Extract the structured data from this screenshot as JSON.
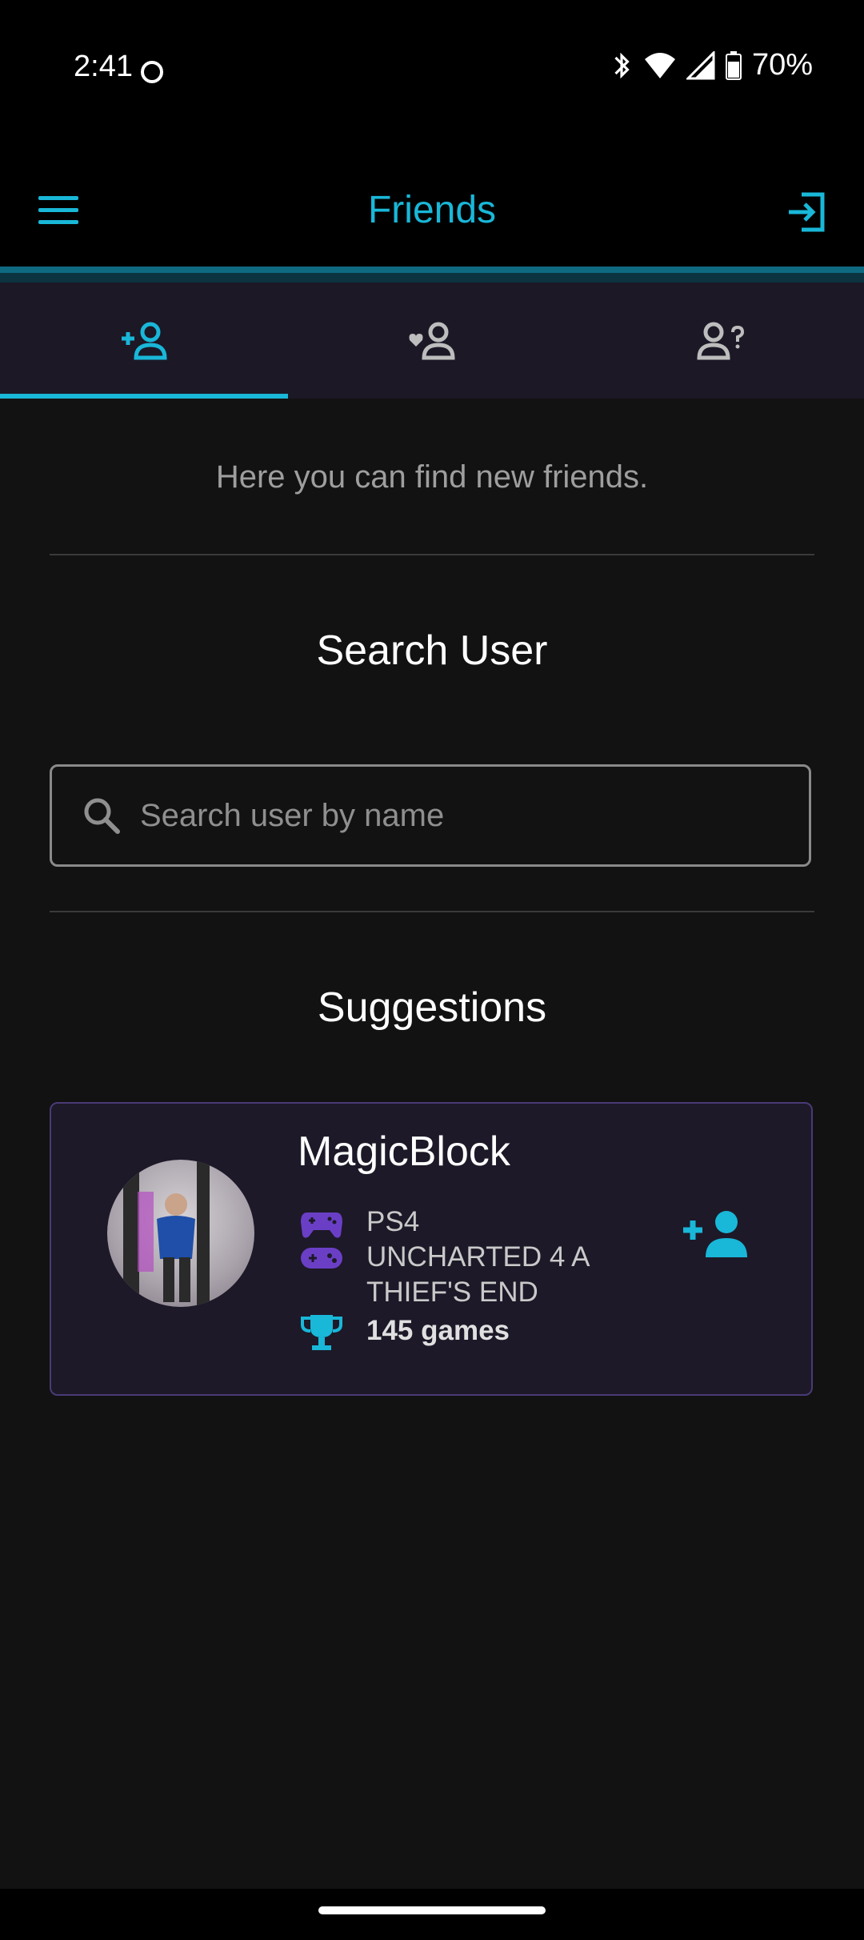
{
  "status_bar": {
    "time": "2:41",
    "battery": "70%"
  },
  "app_bar": {
    "title": "Friends"
  },
  "tabs": [
    {
      "name": "find-friends",
      "icon": "person-add-icon",
      "active": true
    },
    {
      "name": "friends",
      "icon": "person-heart-icon",
      "active": false
    },
    {
      "name": "requests",
      "icon": "person-question-icon",
      "active": false
    }
  ],
  "intro_text": "Here you can find new friends.",
  "search_section": {
    "title": "Search User",
    "placeholder": "Search user by name"
  },
  "suggestions": {
    "title": "Suggestions",
    "items": [
      {
        "username": "MagicBlock",
        "platform": "PS4",
        "game": "UNCHARTED 4 A THIEF'S END",
        "games_count": "145 games"
      }
    ]
  },
  "colors": {
    "accent": "#19b7d8",
    "purple": "#6a3fc6",
    "background": "#121212"
  }
}
